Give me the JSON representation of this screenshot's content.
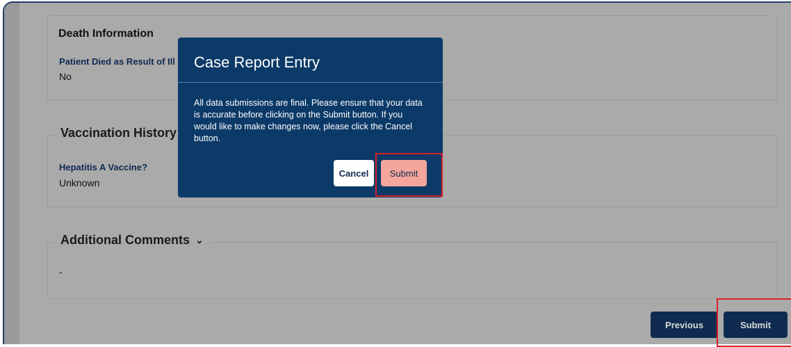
{
  "death": {
    "heading": "Death Information",
    "label": "Patient Died as Result of Ill",
    "value": "No"
  },
  "vaccination": {
    "legend": "Vaccination History",
    "label": "Hepatitis A Vaccine?",
    "value": "Unknown"
  },
  "comments": {
    "legend": "Additional Comments",
    "value": "-"
  },
  "footer": {
    "previous_label": "Previous",
    "submit_label": "Submit"
  },
  "modal": {
    "title": "Case Report Entry",
    "body": "All data submissions are final. Please ensure that your data is accurate before clicking on the Submit button. If you would like to make changes now, please click the Cancel button.",
    "cancel_label": "Cancel",
    "submit_label": "Submit"
  },
  "icons": {
    "chevron": "chevron-down-icon"
  },
  "colors": {
    "modal_bg": "#0c3a68",
    "primary_button": "#0f2b4f",
    "modal_submit": "#f4a59c",
    "highlight": "#d9202a",
    "overlay": "#aaaaaa"
  }
}
